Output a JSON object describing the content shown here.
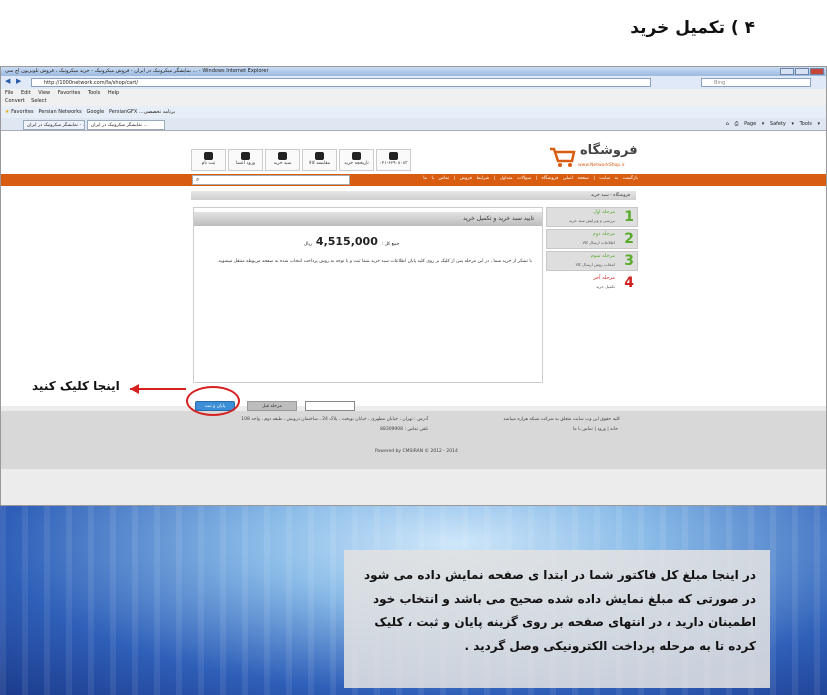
{
  "heading": "۴ ) تکمیل خرید",
  "browser": {
    "title": "نمایشگر میکرونیک در ایران - فروش میکرونیک - خرید میکرونیک ، فروش تلویزیون اچ سی ... - Windows Internet Explorer",
    "address": "http://1000network.com/fa/shop/cart/",
    "search_placeholder": "Bing",
    "menu": [
      "File",
      "Edit",
      "View",
      "Favorites",
      "Tools",
      "Help"
    ],
    "convert": [
      "Convert",
      "Select"
    ],
    "favorites": [
      "Favorites",
      "Persian Networks",
      "Google",
      "PersianGFX",
      "...برنامه تخصصی"
    ],
    "tabs": [
      "نمایشگر میکرونیک در ایران - ...",
      "نمایشگر میکرونیک در ایران ..."
    ],
    "right_tools": [
      "Page ▾",
      "Safety ▾",
      "Tools ▾"
    ]
  },
  "site": {
    "logo_main": "فروشگاه",
    "logo_sub": "www.NetworkShop.ir",
    "top_icons": [
      {
        "label": "۰۲۱-۶۶۹۰۸۰۸۳",
        "icon": "phone-icon"
      },
      {
        "label": "تاریخچه خرید",
        "icon": "history-icon"
      },
      {
        "label": "مقایسه کالا",
        "icon": "compare-icon"
      },
      {
        "label": "سبد خرید",
        "icon": "cart-icon"
      },
      {
        "label": "ورود اعضا",
        "icon": "lock-icon"
      },
      {
        "label": "ثبت نام",
        "icon": "users-icon"
      }
    ],
    "nav": "بازگشت به سایت | صفحه اصلی فروشگاه | سوالات متداول | شرایط فروش | تماس با ما",
    "breadcrumb": "فروشگاه - سبد خرید",
    "panel_title": "تایید سبد خرید و تکمیل خرید",
    "total_label": "جمع کل :",
    "total_value": "4,515,000",
    "total_unit": "ریال",
    "message": "با تشکر از خرید شما ، در این مرحله پس از کلیک بر روی کلید پایان اطلاعات سبد خرید شما ثبت و با توجه به روش پرداخت انتخاب شده به صفحه مربوطه منتقل میشوید.",
    "steps": [
      {
        "num": "1",
        "title": "مرحله اول",
        "sub": "بررسی و ویرایش سبد خرید"
      },
      {
        "num": "2",
        "title": "مرحله دوم",
        "sub": "اطلاعات ارسال کالا"
      },
      {
        "num": "3",
        "title": "مرحله سوم",
        "sub": "انتخاب روش ارسال کالا"
      },
      {
        "num": "4",
        "title": "مرحله آخر",
        "sub": "تکمیل خرید"
      }
    ],
    "pay_button": "پایان و ثبت",
    "prev_button": "مرحله قبل",
    "footer_copyright": "کلیه حقوق این وب سایت متعلق به شرکت شبکه هزاره میباشد",
    "footer_links": "خانه | ورود | تماس با ما",
    "footer_address": "آدرس : تهران ، خیابان مطهری ، خیابان نوبخت ، پلاک 24 ، ساختمان درویش ، طبقه دوم ، واحد 108",
    "footer_phone": "تلفن تماس : 88309908",
    "footer_powered": "Powered by CMSIRAN © 2012 - 2014"
  },
  "callout": "اینجا کلیک کنید",
  "instructions": [
    "در اینجا مبلغ کل فاکتور شما در ابتدا ی صفحه نمایش داده می شود",
    "در صورتی که مبلغ نمایش داده شده صحیح می باشد و انتخاب خود",
    "اطمینان دارید ، در انتهای صفحه بر روی گزینه پایان و ثبت ، کلیک",
    "کرده تا به مرحله پرداخت الکترونیکی وصل گردید ."
  ]
}
